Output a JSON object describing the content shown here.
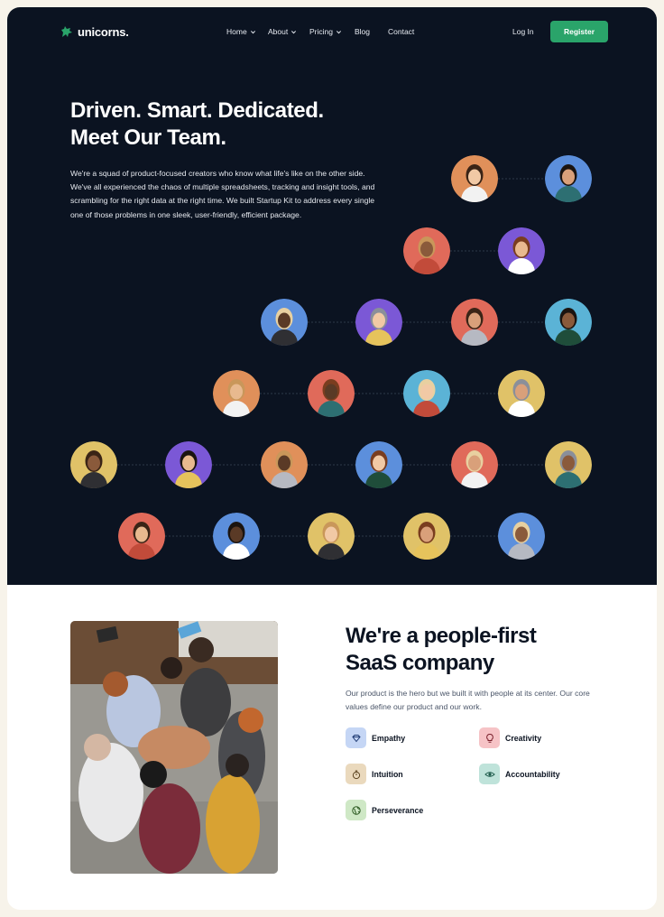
{
  "brand": {
    "name": "unicorns.",
    "accent": "#2aa46a"
  },
  "nav": {
    "items": [
      {
        "label": "Home",
        "has_dropdown": true
      },
      {
        "label": "About",
        "has_dropdown": true
      },
      {
        "label": "Pricing",
        "has_dropdown": true
      },
      {
        "label": "Blog",
        "has_dropdown": false
      },
      {
        "label": "Contact",
        "has_dropdown": false
      }
    ],
    "login": "Log In",
    "register": "Register"
  },
  "hero": {
    "title_line1": "Driven. Smart. Dedicated.",
    "title_line2": "Meet Our Team.",
    "description": "We're a squad of product-focused creators who know what life's like on the other side. We've all experienced the chaos of multiple spreadsheets, tracking and insight tools, and scrambling for the right data at the right time. We built Startup Kit to address every single one of those problems in one sleek, user-friendly, efficient package.",
    "background": "#0b1321"
  },
  "team": {
    "avatar_colors": [
      "#e0905a",
      "#5c8fdc",
      "#e06a5a",
      "#7b58d6",
      "#e0c268",
      "#5bb3d6"
    ],
    "member_count": 23
  },
  "about": {
    "title_line1": "We're a people-first",
    "title_line2": "SaaS company",
    "description": "Our product is the hero but we built it with people at its center. Our core values define our product and our work.",
    "values": [
      {
        "label": "Empathy",
        "icon": "diamond-icon",
        "bg": "#c5d6f5",
        "fg": "#1f3b73"
      },
      {
        "label": "Creativity",
        "icon": "lightbulb-icon",
        "bg": "#f6c3c6",
        "fg": "#7a1f2b"
      },
      {
        "label": "Intuition",
        "icon": "stopwatch-icon",
        "bg": "#ead9bd",
        "fg": "#5b4320"
      },
      {
        "label": "Accountability",
        "icon": "eye-icon",
        "bg": "#bfe3da",
        "fg": "#1d5a4a"
      },
      {
        "label": "Perseverance",
        "icon": "globe-icon",
        "bg": "#cfe8c6",
        "fg": "#2d5a22"
      }
    ]
  }
}
